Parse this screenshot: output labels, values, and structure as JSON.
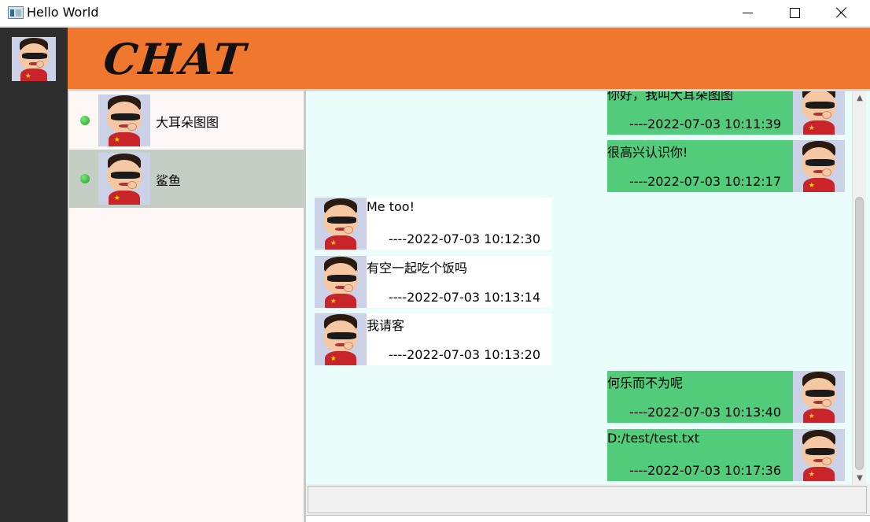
{
  "window": {
    "title": "Hello World",
    "controls": [
      "minimize",
      "maximize",
      "close"
    ]
  },
  "header": {
    "logo_text": "CHAT",
    "accent_color": "#f0782e"
  },
  "contacts": [
    {
      "name": "大耳朵图图",
      "online": true,
      "selected": false
    },
    {
      "name": "鲨鱼",
      "online": true,
      "selected": true
    }
  ],
  "messages": [
    {
      "side": "right",
      "text": "你好，我叫大耳朵图图",
      "time": "----2022-07-03 10:11:39"
    },
    {
      "side": "right",
      "text": "很高兴认识你!",
      "time": "----2022-07-03 10:12:17"
    },
    {
      "side": "left",
      "text": "Me too!",
      "time": "----2022-07-03 10:12:30"
    },
    {
      "side": "left",
      "text": "有空一起吃个饭吗",
      "time": "----2022-07-03 10:13:14"
    },
    {
      "side": "left",
      "text": "我请客",
      "time": "----2022-07-03 10:13:20"
    },
    {
      "side": "right",
      "text": "何乐而不为呢",
      "time": "----2022-07-03 10:13:40"
    },
    {
      "side": "right",
      "text": "D:/test/test.txt",
      "time": "----2022-07-03 10:17:36"
    }
  ],
  "colors": {
    "sent_bubble": "#52cc7a",
    "received_bubble": "#ffffff",
    "chat_background": "#ebfdfa",
    "rail": "#2e2e2e",
    "online_dot": "#1e9e1e"
  },
  "input": {
    "value": ""
  }
}
